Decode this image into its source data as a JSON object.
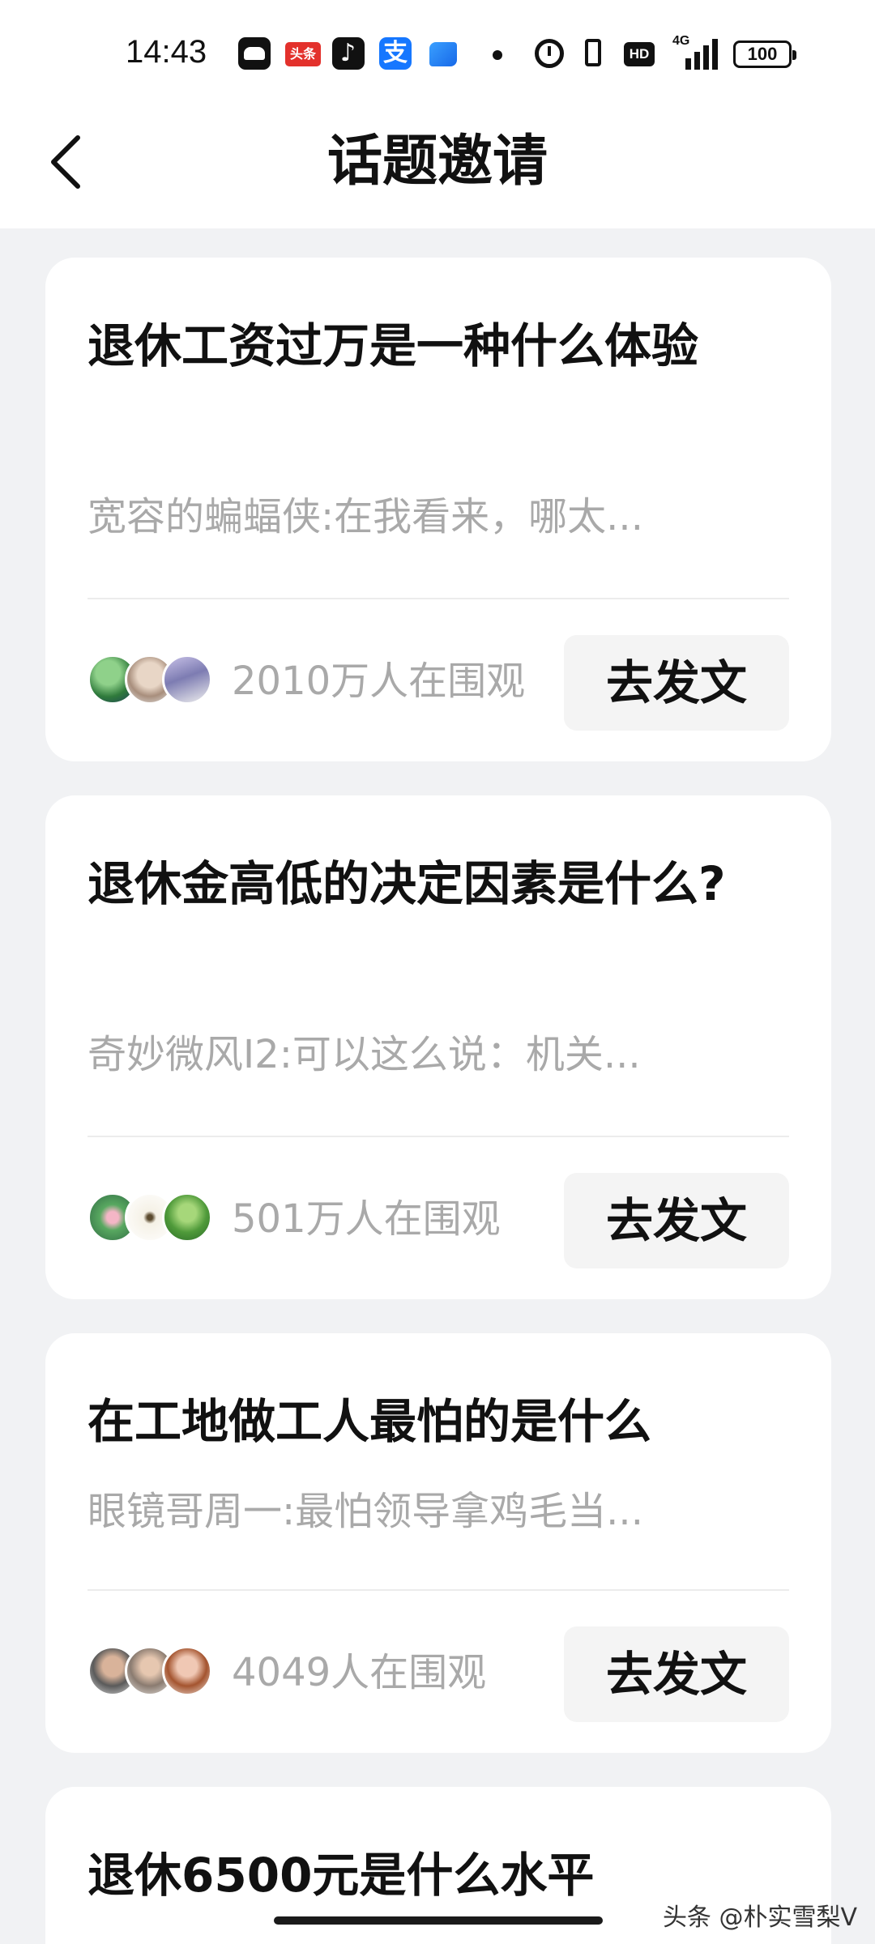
{
  "status_bar": {
    "time": "14:43",
    "app_icons": [
      "panda-app-icon",
      "toutiao-icon",
      "douyin-icon",
      "alipay-icon",
      "app-icon"
    ],
    "toutiao_label": "头条",
    "alipay_label": "支",
    "indicators": [
      "alarm-icon",
      "vibrate-icon",
      "hd-icon",
      "signal-icon",
      "battery-icon"
    ],
    "hd_label": "HD",
    "network": "4G",
    "battery": "100"
  },
  "header": {
    "title": "话题邀请",
    "back_icon": "chevron-left-icon"
  },
  "topics": [
    {
      "title": "退休工资过万是一种什么体验",
      "excerpt": "宽容的蝙蝠侠:在我看来，哪太...",
      "viewers": "2010万人在围观",
      "button": "去发文",
      "avatars": [
        "avatar-landscape",
        "avatar-elder",
        "avatar-abstract"
      ]
    },
    {
      "title": "退休金高低的决定因素是什么?",
      "excerpt": "奇妙微风I2:可以这么说：机关...",
      "viewers": "501万人在围观",
      "button": "去发文",
      "avatars": [
        "avatar-lotus",
        "avatar-calligraphy",
        "avatar-tree"
      ]
    },
    {
      "title": "在工地做工人最怕的是什么",
      "excerpt": "眼镜哥周一:最怕领导拿鸡毛当...",
      "viewers": "4049人在围观",
      "button": "去发文",
      "avatars": [
        "avatar-man",
        "avatar-group",
        "avatar-smiling"
      ]
    },
    {
      "title": "退休6500元是什么水平",
      "excerpt": "",
      "viewers": "",
      "button": "",
      "avatars": []
    }
  ],
  "watermark": "头条 @朴实雪梨V",
  "colors": {
    "page_bg": "#f1f2f4",
    "card_bg": "#ffffff",
    "muted_text": "#a9a9a9",
    "button_bg": "#f4f4f4"
  }
}
